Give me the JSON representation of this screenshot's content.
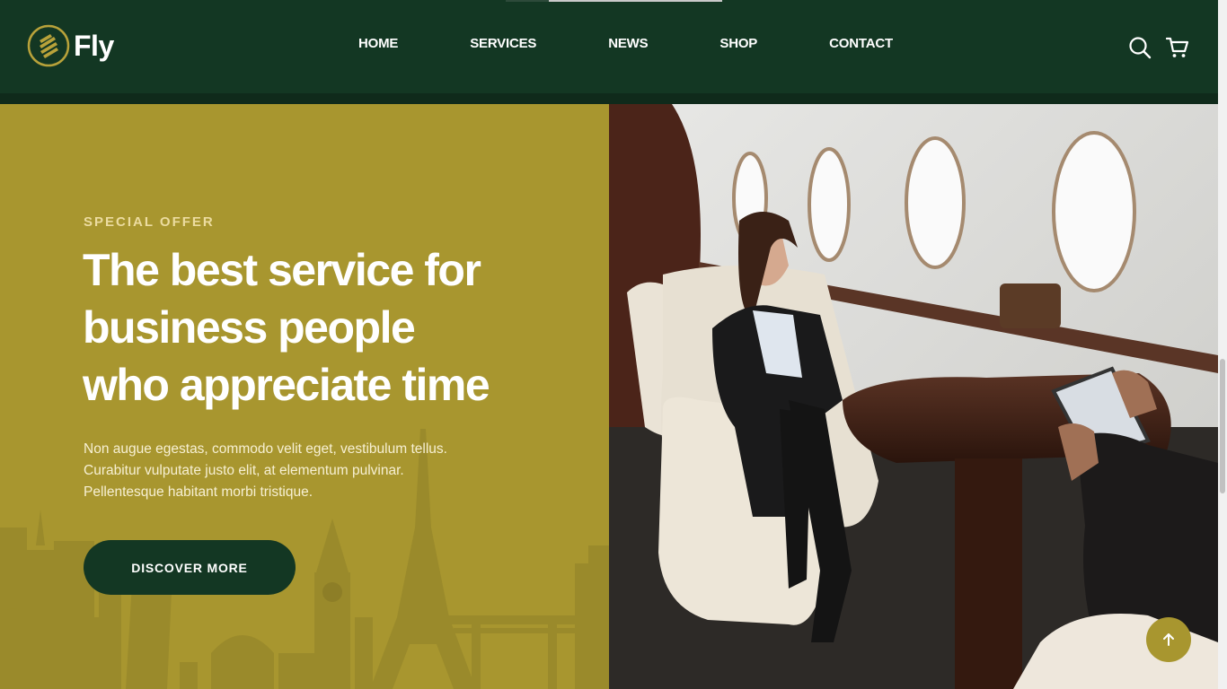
{
  "brand": {
    "name": "Fly"
  },
  "nav": {
    "items": [
      {
        "label": "HOME"
      },
      {
        "label": "SERVICES"
      },
      {
        "label": "NEWS"
      },
      {
        "label": "SHOP"
      },
      {
        "label": "CONTACT"
      }
    ]
  },
  "header_icons": {
    "search": "search-icon",
    "cart": "cart-icon"
  },
  "hero": {
    "eyebrow": "SPECIAL OFFER",
    "headline_lines": [
      "The best service for",
      "business people",
      "who appreciate time"
    ],
    "paragraph_lines": [
      "Non augue egestas, commodo velit eget, vestibulum tellus.",
      "Curabitur vulputate justo elit, at elementum pulvinar.",
      "Pellentesque habitant morbi tristique."
    ],
    "cta_label": "DISCOVER MORE"
  },
  "scroll_top": {
    "icon": "arrow-up-icon"
  },
  "colors": {
    "header_bg": "#133723",
    "accent_olive": "#a8962f",
    "eyebrow": "#ecdca0",
    "cta_bg": "#133723"
  }
}
